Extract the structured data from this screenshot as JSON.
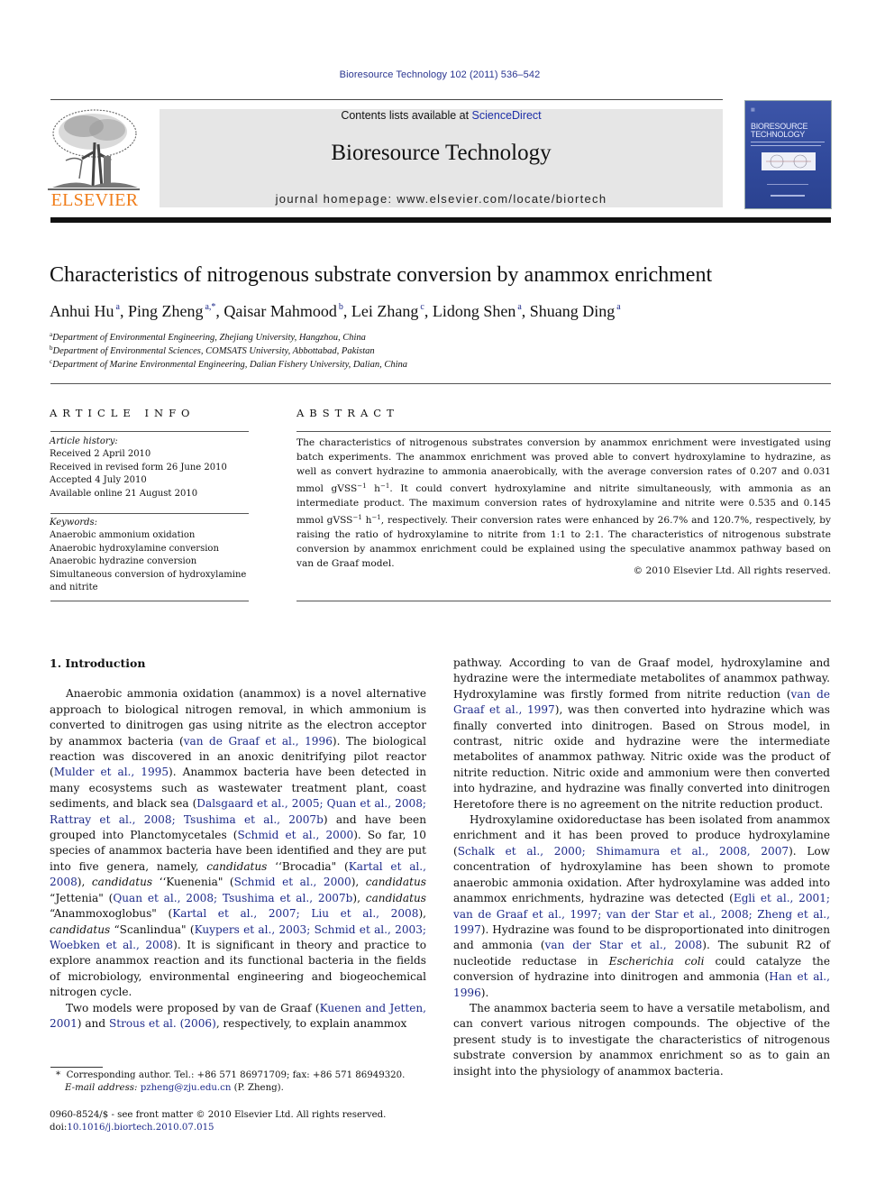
{
  "header": {
    "citation": "Bioresource Technology 102 (2011) 536–542",
    "contents_prefix": "Contents lists available at ",
    "contents_link": "ScienceDirect",
    "journal_name": "Bioresource Technology",
    "homepage": "journal homepage: www.elsevier.com/locate/biortech",
    "publisher_logo_text": "ELSEVIER",
    "cover": {
      "title_line1": "BIORESOURCE",
      "title_line2": "TECHNOLOGY"
    },
    "colors": {
      "publisher_orange": "#f07d1a",
      "link_blue": "#1d2a8a",
      "banner_gray": "#e6e6e6",
      "cover_blue": "#3550a2"
    }
  },
  "article": {
    "title": "Characteristics of nitrogenous substrate conversion by anammox enrichment",
    "authors": [
      {
        "name": "Anhui Hu",
        "aff": "a"
      },
      {
        "name": "Ping Zheng",
        "aff": "a,*"
      },
      {
        "name": "Qaisar Mahmood",
        "aff": "b"
      },
      {
        "name": "Lei Zhang",
        "aff": "c"
      },
      {
        "name": "Lidong Shen",
        "aff": "a"
      },
      {
        "name": "Shuang Ding",
        "aff": "a"
      }
    ],
    "affiliations": [
      {
        "key": "a",
        "text": "Department of Environmental Engineering, Zhejiang University, Hangzhou, China"
      },
      {
        "key": "b",
        "text": "Department of Environmental Sciences, COMSATS University, Abbottabad, Pakistan"
      },
      {
        "key": "c",
        "text": "Department of Marine Environmental Engineering, Dalian Fishery University, Dalian, China"
      }
    ]
  },
  "article_info": {
    "heading": "ARTICLE INFO",
    "history_label": "Article history:",
    "history": [
      "Received 2 April 2010",
      "Received in revised form 26 June 2010",
      "Accepted 4 July 2010",
      "Available online 21 August 2010"
    ],
    "keywords_label": "Keywords:",
    "keywords": [
      "Anaerobic ammonium oxidation",
      "Anaerobic hydroxylamine conversion",
      "Anaerobic hydrazine conversion",
      "Simultaneous conversion of hydroxylamine and nitrite"
    ]
  },
  "abstract": {
    "heading": "ABSTRACT",
    "parts": [
      "The characteristics of nitrogenous substrates conversion by anammox enrichment were investigated using batch experiments. The anammox enrichment was proved able to convert hydroxylamine to hydrazine, as well as convert hydrazine to ammonia anaerobically, with the average conversion rates of 0.207 and 0.031 mmol gVSS",
      "−1",
      " h",
      "−1",
      ". It could convert hydroxylamine and nitrite simultaneously, with ammonia as an intermediate product. The maximum conversion rates of hydroxylamine and nitrite were 0.535 and 0.145 mmol gVSS",
      "−1",
      " h",
      "−1",
      ", respectively. Their conversion rates were enhanced by 26.7% and 120.7%, respectively, by raising the ratio of hydroxylamine to nitrite from 1:1 to 2:1. The characteristics of nitrogenous substrate conversion by anammox enrichment could be explained using the speculative anammox pathway based on van de Graaf model."
    ],
    "copyright": "© 2010 Elsevier Ltd. All rights reserved."
  },
  "body": {
    "section_heading": "1. Introduction",
    "col1": {
      "p1": [
        {
          "t": "Anaerobic ammonia oxidation (anammox) is a novel alternative approach to biological nitrogen removal, in which ammonium is converted to dinitrogen gas using nitrite as the electron acceptor by anammox bacteria ("
        },
        {
          "t": "van de Graaf et al., 1996",
          "link": true
        },
        {
          "t": "). The biological reaction was discovered in an anoxic denitrifying pilot reactor ("
        },
        {
          "t": "Mulder et al., 1995",
          "link": true
        },
        {
          "t": "). Anammox bacteria have been detected in many ecosystems such as wastewater treatment plant, coast sediments, and black sea ("
        },
        {
          "t": "Dalsgaard et al., 2005; Quan et al., 2008; Rattray et al., 2008; Tsushima et al., 2007b",
          "link": true
        },
        {
          "t": ") and have been grouped into Planctomycetales ("
        },
        {
          "t": "Schmid et al., 2000",
          "link": true
        },
        {
          "t": "). So far, 10 species of anammox bacteria have been identified and they are put into five genera, namely, "
        },
        {
          "t": "candidatus",
          "italic": true
        },
        {
          "t": " ‘‘Brocadia\" ("
        },
        {
          "t": "Kartal et al., 2008",
          "link": true
        },
        {
          "t": "), "
        },
        {
          "t": "candidatus",
          "italic": true
        },
        {
          "t": " ‘‘Kuenenia\" ("
        },
        {
          "t": "Schmid et al., 2000",
          "link": true
        },
        {
          "t": "), "
        },
        {
          "t": "candidatus",
          "italic": true
        },
        {
          "t": " “Jettenia\" ("
        },
        {
          "t": "Quan et al., 2008; Tsushima et al., 2007b",
          "link": true
        },
        {
          "t": "), "
        },
        {
          "t": "candidatus",
          "italic": true
        },
        {
          "t": " “Anammoxoglobus\" ("
        },
        {
          "t": "Kartal et al., 2007; Liu et al., 2008",
          "link": true
        },
        {
          "t": "), "
        },
        {
          "t": "candidatus",
          "italic": true
        },
        {
          "t": " “Scanlindua\" ("
        },
        {
          "t": "Kuypers et al., 2003; Schmid et al., 2003; Woebken et al., 2008",
          "link": true
        },
        {
          "t": "). It is significant in theory and practice to explore anammox reaction and its functional bacteria in the fields of microbiology, environmental engineering and biogeochemical nitrogen cycle."
        }
      ],
      "p2": [
        {
          "t": "Two models were proposed by van de Graaf ("
        },
        {
          "t": "Kuenen and Jetten, 2001",
          "link": true
        },
        {
          "t": ") and "
        },
        {
          "t": "Strous et al. (2006)",
          "link": true
        },
        {
          "t": ", respectively, to explain anammox"
        }
      ]
    },
    "col2": {
      "p1": [
        {
          "t": "pathway. According to van de Graaf model, hydroxylamine and hydrazine were the intermediate metabolites of anammox pathway. Hydroxylamine was firstly formed from nitrite reduction ("
        },
        {
          "t": "van de Graaf et al., 1997",
          "link": true
        },
        {
          "t": "), was then converted into hydrazine which was finally converted into dinitrogen. Based on Strous model, in contrast, nitric oxide and hydrazine were the intermediate metabolites of anammox pathway. Nitric oxide was the product of nitrite reduction. Nitric oxide and ammonium were then converted into hydrazine, and hydrazine was finally converted into dinitrogen Heretofore there is no agreement on the nitrite reduction product."
        }
      ],
      "p2": [
        {
          "t": "Hydroxylamine oxidoreductase has been isolated from anammox enrichment and it has been proved to produce hydroxylamine ("
        },
        {
          "t": "Schalk et al., 2000; Shimamura et al., 2008, 2007",
          "link": true
        },
        {
          "t": "). Low concentration of hydroxylamine has been shown to promote anaerobic ammonia oxidation. After hydroxylamine was added into anammox enrichments, hydrazine was detected ("
        },
        {
          "t": "Egli et al., 2001; van de Graaf et al., 1997; van der Star et al., 2008; Zheng et al., 1997",
          "link": true
        },
        {
          "t": "). Hydrazine was found to be disproportionated into dinitrogen and ammonia ("
        },
        {
          "t": "van der Star et al., 2008",
          "link": true
        },
        {
          "t": "). The subunit R2 of nucleotide reductase in "
        },
        {
          "t": "Escherichia coli",
          "italic": true
        },
        {
          "t": " could catalyze the conversion of hydrazine into dinitrogen and ammonia ("
        },
        {
          "t": "Han et al., 1996",
          "link": true
        },
        {
          "t": ")."
        }
      ],
      "p3": [
        {
          "t": "The anammox bacteria seem to have a versatile metabolism, and can convert various nitrogen compounds. The objective of the present study is to investigate the characteristics of nitrogenous substrate conversion by anammox enrichment so as to gain an insight into the physiology of anammox bacteria."
        }
      ]
    }
  },
  "footnote": {
    "marker": "*",
    "corresponding": "Corresponding author. Tel.: +86 571 86971709; fax: +86 571 86949320.",
    "email_label": "E-mail address:",
    "email": "pzheng@zju.edu.cn",
    "email_suffix": " (P. Zheng)."
  },
  "front_matter": {
    "issn_line": "0960-8524/$ - see front matter © 2010 Elsevier Ltd. All rights reserved.",
    "doi_label": "doi:",
    "doi": "10.1016/j.biortech.2010.07.015"
  }
}
